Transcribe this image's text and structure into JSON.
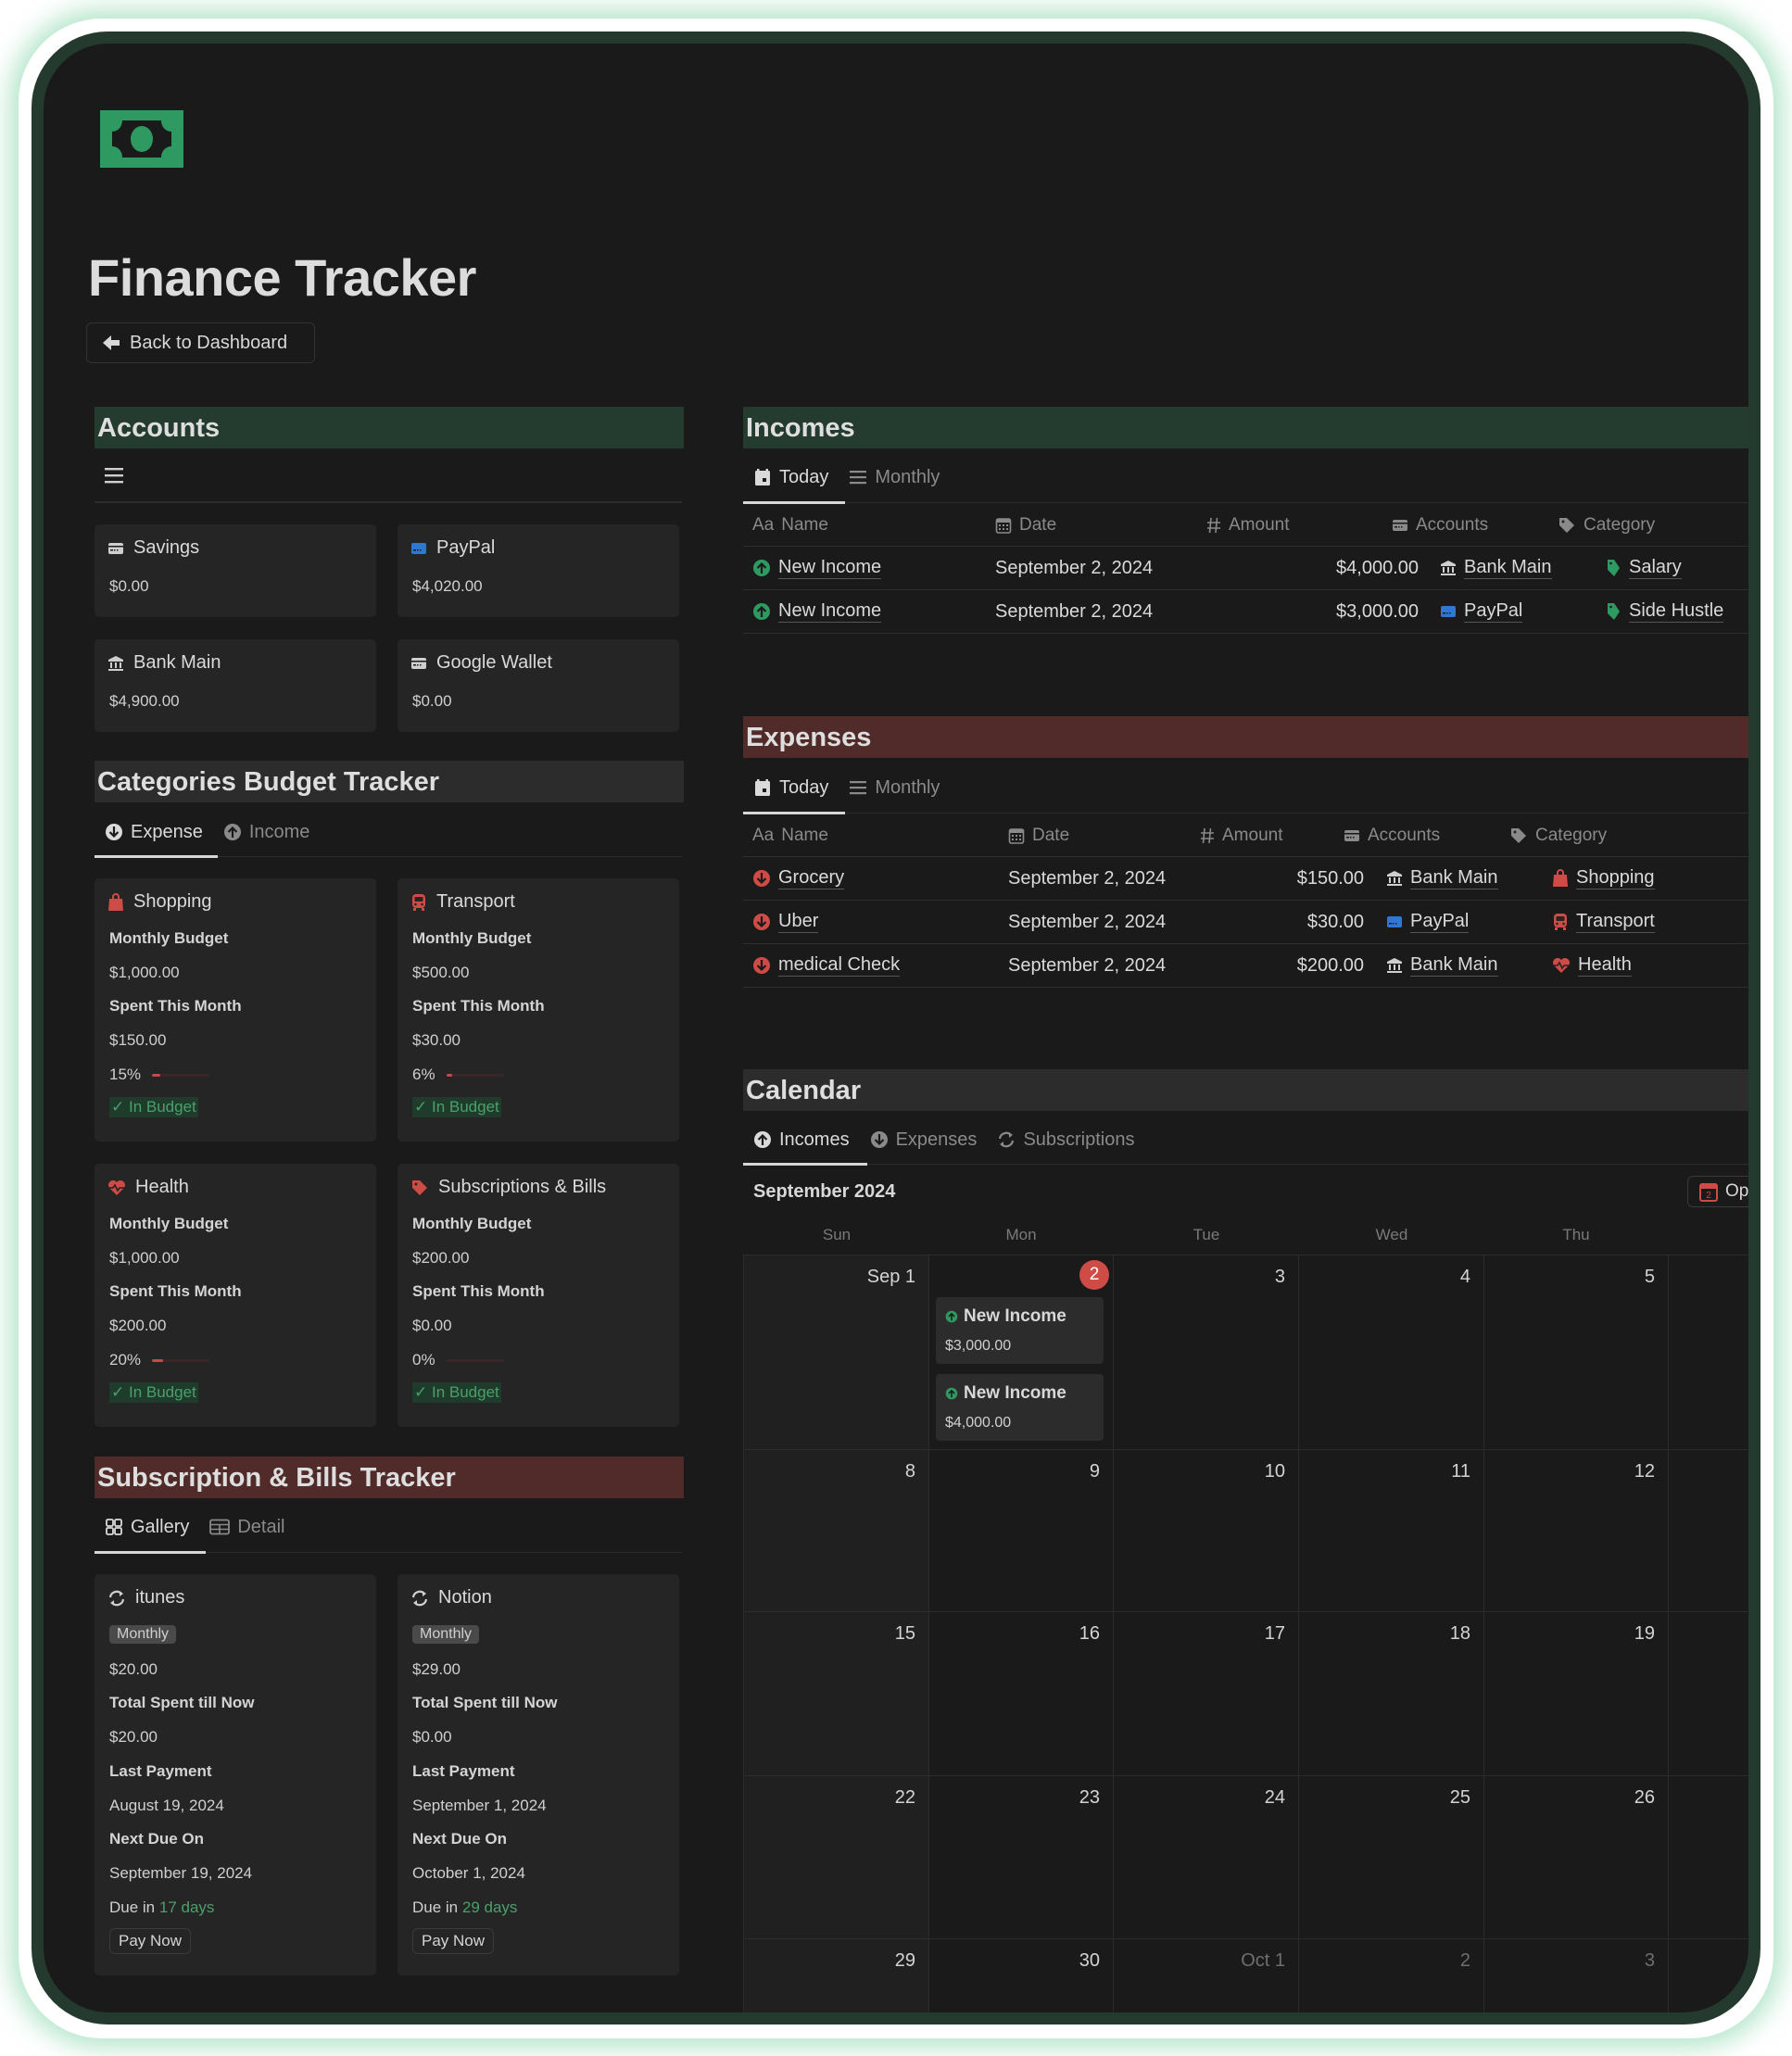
{
  "page": {
    "title": "Finance Tracker",
    "logo_icon": "banknote-icon",
    "back_button": "Back to Dashboard"
  },
  "colors": {
    "frame_border": "#253a2e",
    "frame_glow": "#78d2a0",
    "background": "#1a1a1a",
    "card": "#252525",
    "income_green": "#2e9a62",
    "expense_red": "#cf4b46",
    "accounts_header": "#243c2f",
    "expenses_header": "#502b29",
    "calendar_header": "#2c2c2c",
    "in_budget_text": "#4aa06b"
  },
  "accounts": {
    "title": "Accounts",
    "view_icon": "list-icon",
    "items": [
      {
        "name": "Savings",
        "icon": "card-icon",
        "balance": "$0.00"
      },
      {
        "name": "PayPal",
        "icon": "card-blue-icon",
        "balance": "$4,020.00"
      },
      {
        "name": "Bank Main",
        "icon": "bank-icon",
        "balance": "$4,900.00"
      },
      {
        "name": "Google Wallet",
        "icon": "card-icon",
        "balance": "$0.00"
      }
    ]
  },
  "budget": {
    "title": "Categories Budget Tracker",
    "tabs": [
      {
        "label": "Expense",
        "icon": "arrow-down-circle-icon",
        "active": true
      },
      {
        "label": "Income",
        "icon": "arrow-up-circle-icon",
        "active": false
      }
    ],
    "budget_label": "Monthly Budget",
    "spent_label": "Spent This Month",
    "status_label": "✓ In Budget",
    "items": [
      {
        "name": "Shopping",
        "icon": "shopping-bag-icon",
        "budget": "$1,000.00",
        "spent": "$150.00",
        "percent_label": "15%",
        "percent": 15
      },
      {
        "name": "Transport",
        "icon": "bus-icon",
        "budget": "$500.00",
        "spent": "$30.00",
        "percent_label": "6%",
        "percent": 6
      },
      {
        "name": "Health",
        "icon": "heart-pulse-icon",
        "budget": "$1,000.00",
        "spent": "$200.00",
        "percent_label": "20%",
        "percent": 20
      },
      {
        "name": "Subscriptions & Bills",
        "icon": "tag-icon",
        "budget": "$200.00",
        "spent": "$0.00",
        "percent_label": "0%",
        "percent": 0
      }
    ]
  },
  "subscriptions": {
    "title": "Subscription & Bills Tracker",
    "tabs": [
      {
        "label": "Gallery",
        "icon": "gallery-icon",
        "active": true
      },
      {
        "label": "Detail",
        "icon": "table-icon",
        "active": false
      }
    ],
    "total_label": "Total Spent till Now",
    "last_label": "Last Payment",
    "next_label": "Next Due On",
    "due_prefix": "Due in",
    "pay_label": "Pay Now",
    "items": [
      {
        "name": "itunes",
        "icon": "repeat-icon",
        "frequency": "Monthly",
        "price": "$20.00",
        "total_spent": "$20.00",
        "last_payment": "August 19, 2024",
        "next_due": "September 19, 2024",
        "due_in": "17 days"
      },
      {
        "name": "Notion",
        "icon": "repeat-icon",
        "frequency": "Monthly",
        "price": "$29.00",
        "total_spent": "$0.00",
        "last_payment": "September 1, 2024",
        "next_due": "October 1, 2024",
        "due_in": "29 days"
      }
    ]
  },
  "incomes": {
    "title": "Incomes",
    "tabs": [
      {
        "label": "Today",
        "icon": "calendar-day-icon",
        "active": true
      },
      {
        "label": "Monthly",
        "icon": "list-icon",
        "active": false
      }
    ],
    "columns": [
      {
        "label": "Name",
        "prefix": "Aa"
      },
      {
        "label": "Date",
        "icon": "calendar-icon"
      },
      {
        "label": "Amount",
        "icon": "hash-icon"
      },
      {
        "label": "Accounts",
        "icon": "card-icon"
      },
      {
        "label": "Category",
        "icon": "tag-icon"
      }
    ],
    "rows": [
      {
        "name": "New Income",
        "date": "September 2, 2024",
        "amount": "$4,000.00",
        "account": "Bank Main",
        "account_icon": "bank-icon",
        "category": "Salary",
        "category_icon": "tag-green-icon"
      },
      {
        "name": "New Income",
        "date": "September 2, 2024",
        "amount": "$3,000.00",
        "account": "PayPal",
        "account_icon": "card-blue-icon",
        "category": "Side Hustle",
        "category_icon": "tag-green-icon"
      }
    ]
  },
  "expenses": {
    "title": "Expenses",
    "tabs": [
      {
        "label": "Today",
        "icon": "calendar-day-icon",
        "active": true
      },
      {
        "label": "Monthly",
        "icon": "list-icon",
        "active": false
      }
    ],
    "columns": [
      {
        "label": "Name",
        "prefix": "Aa"
      },
      {
        "label": "Date",
        "icon": "calendar-icon"
      },
      {
        "label": "Amount",
        "icon": "hash-icon"
      },
      {
        "label": "Accounts",
        "icon": "card-icon"
      },
      {
        "label": "Category",
        "icon": "tag-icon"
      }
    ],
    "rows": [
      {
        "name": "Grocery",
        "date": "September 2, 2024",
        "amount": "$150.00",
        "account": "Bank Main",
        "account_icon": "bank-icon",
        "category": "Shopping",
        "category_icon": "shopping-bag-icon"
      },
      {
        "name": "Uber",
        "date": "September 2, 2024",
        "amount": "$30.00",
        "account": "PayPal",
        "account_icon": "card-blue-icon",
        "category": "Transport",
        "category_icon": "bus-icon"
      },
      {
        "name": "medical Check",
        "date": "September 2, 2024",
        "amount": "$200.00",
        "account": "Bank Main",
        "account_icon": "bank-icon",
        "category": "Health",
        "category_icon": "heart-pulse-icon"
      }
    ]
  },
  "calendar": {
    "title": "Calendar",
    "tabs": [
      {
        "label": "Incomes",
        "icon": "arrow-up-circle-icon",
        "active": true
      },
      {
        "label": "Expenses",
        "icon": "arrow-down-circle-icon",
        "active": false
      },
      {
        "label": "Subscriptions",
        "icon": "repeat-icon",
        "active": false
      }
    ],
    "month_label": "September 2024",
    "open_button": "Op",
    "weekdays": [
      "Sun",
      "Mon",
      "Tue",
      "Wed",
      "Thu"
    ],
    "weeks": [
      [
        {
          "label": "Sep 1"
        },
        {
          "label": "2",
          "today": true
        },
        {
          "label": "3"
        },
        {
          "label": "4"
        },
        {
          "label": "5"
        },
        {
          "label": ""
        }
      ],
      [
        {
          "label": "8"
        },
        {
          "label": "9"
        },
        {
          "label": "10"
        },
        {
          "label": "11"
        },
        {
          "label": "12"
        },
        {
          "label": ""
        }
      ],
      [
        {
          "label": "15"
        },
        {
          "label": "16"
        },
        {
          "label": "17"
        },
        {
          "label": "18"
        },
        {
          "label": "19"
        },
        {
          "label": ""
        }
      ],
      [
        {
          "label": "22"
        },
        {
          "label": "23"
        },
        {
          "label": "24"
        },
        {
          "label": "25"
        },
        {
          "label": "26"
        },
        {
          "label": ""
        }
      ],
      [
        {
          "label": "29"
        },
        {
          "label": "30"
        },
        {
          "label": "Oct 1",
          "faded": true
        },
        {
          "label": "2",
          "faded": true
        },
        {
          "label": "3",
          "faded": true
        },
        {
          "label": ""
        }
      ]
    ],
    "events": [
      {
        "title": "New Income",
        "amount": "$3,000.00",
        "icon": "arrow-up-circle-icon"
      },
      {
        "title": "New Income",
        "amount": "$4,000.00",
        "icon": "arrow-up-circle-icon"
      }
    ]
  }
}
